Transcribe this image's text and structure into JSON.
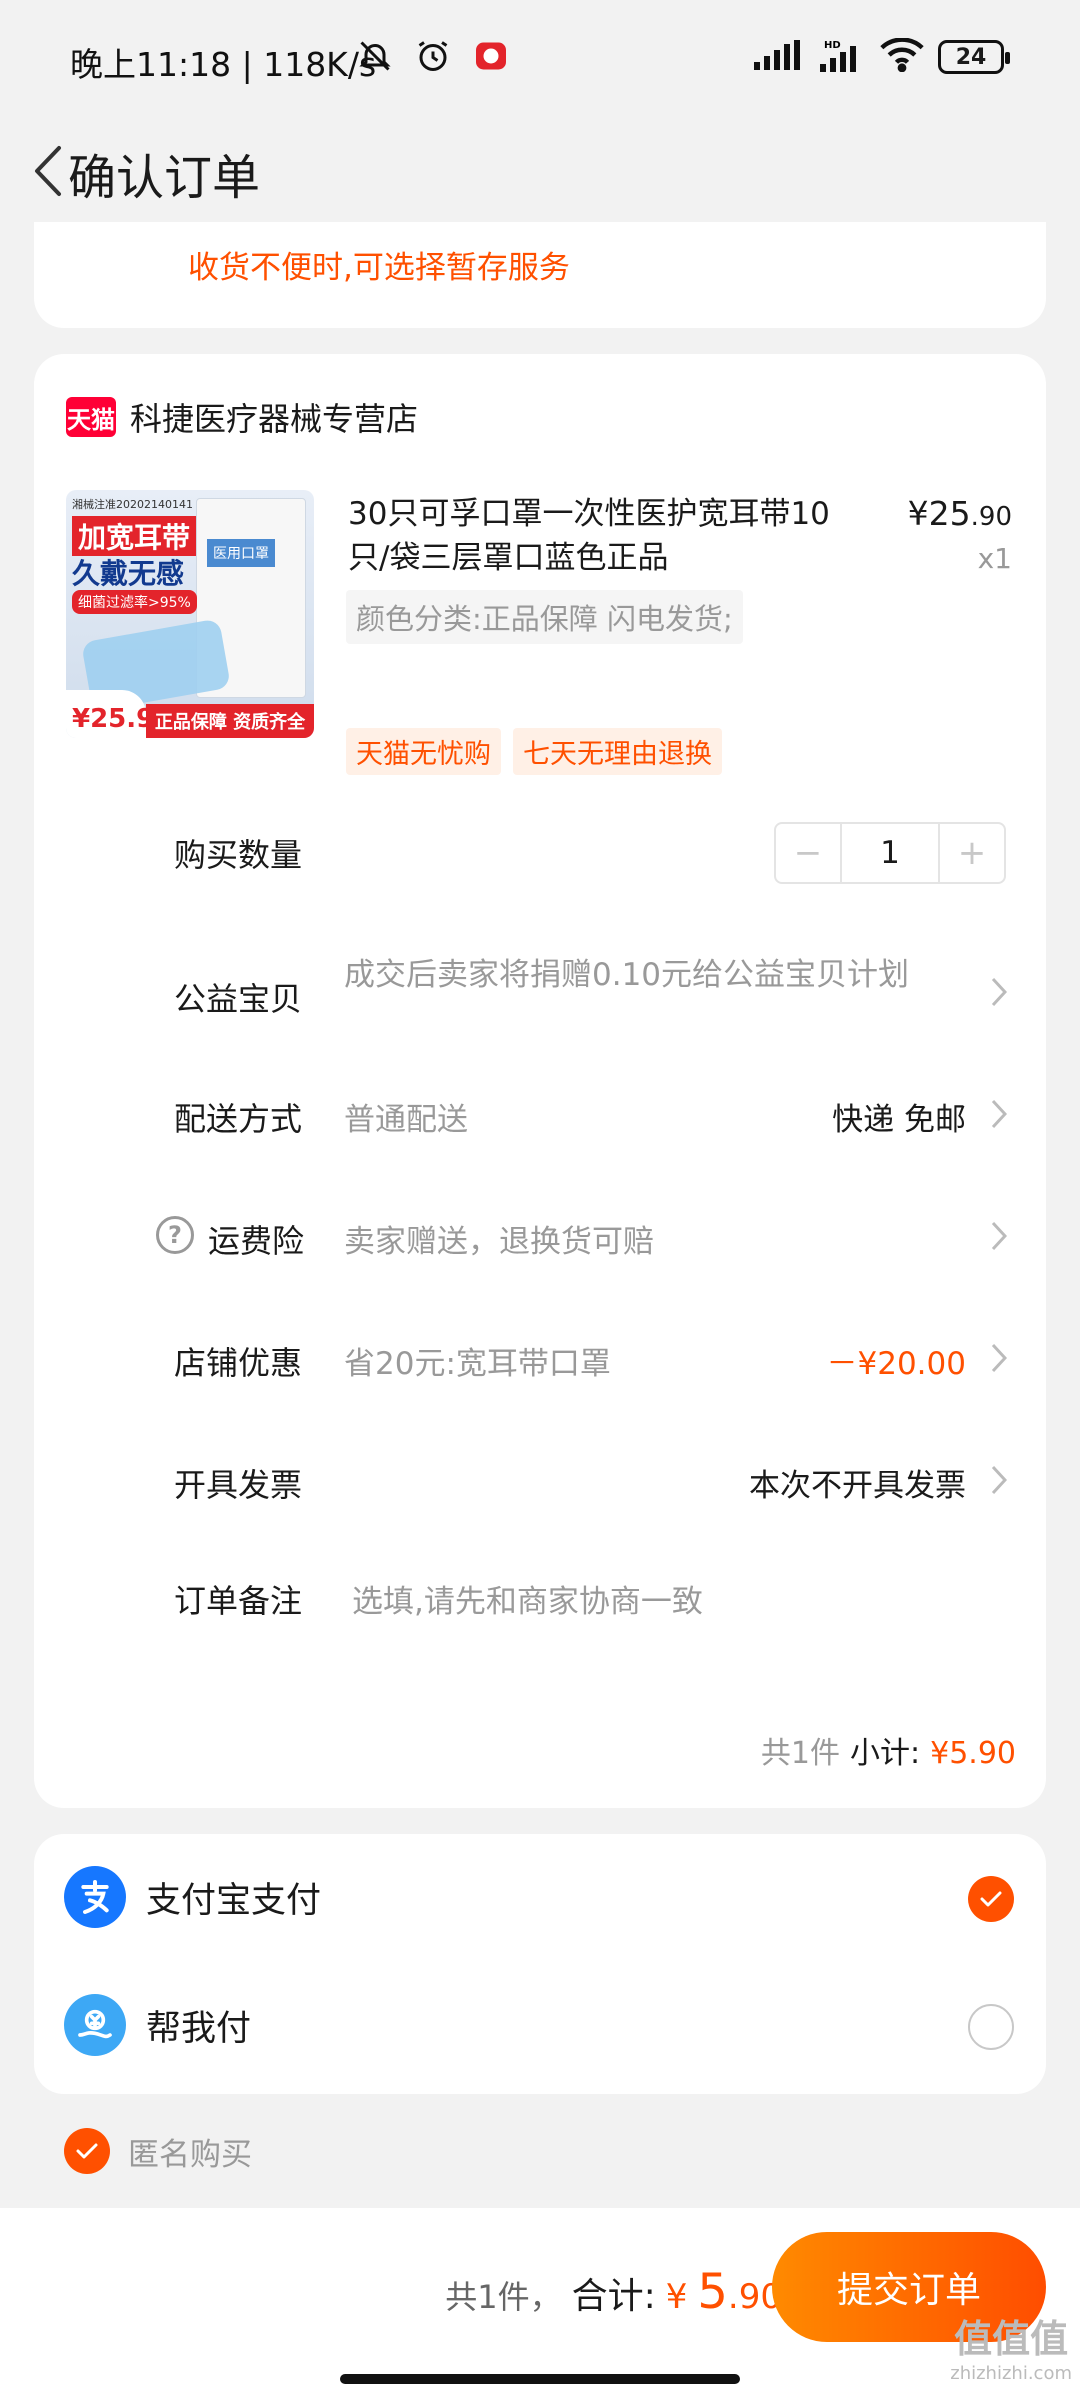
{
  "status_bar": {
    "time": "晚上11:18 | 118K/s",
    "battery": "24"
  },
  "nav": {
    "title": "确认订单"
  },
  "top_card": {
    "tip": "收货不便时,可选择暂存服务"
  },
  "store": {
    "badge": "天猫",
    "name": "科捷医疗器械专营店"
  },
  "product": {
    "image_text": {
      "tag": "湘械注准20202140141",
      "title1": "加宽耳带",
      "title2": "久戴无感",
      "title3": "细菌过滤率>95%",
      "pack_label": "医用口罩",
      "price_tag": "¥25.9",
      "banner": "正品保障 资质齐全"
    },
    "title": "30只可孚口罩一次性医护宽耳带10只/袋三层罩口蓝色正品",
    "price_int": "¥25",
    "price_dec": ".90",
    "qty": "x1",
    "spec": "颜色分类:正品保障 闪电发货;",
    "tags": [
      "天猫无忧购",
      "七天无理由退换"
    ]
  },
  "rows": {
    "quantity": {
      "label": "购买数量",
      "value": "1",
      "minus": "−",
      "plus": "+"
    },
    "charity": {
      "label": "公益宝贝",
      "sub": "成交后卖家将捐赠0.10元给公益宝贝计划"
    },
    "delivery": {
      "label": "配送方式",
      "sub": "普通配送",
      "value": "快递 免邮"
    },
    "freight_insurance": {
      "label": "运费险",
      "sub": "卖家赠送，退换货可赔"
    },
    "store_discount": {
      "label": "店铺优惠",
      "sub": "省20元:宽耳带口罩",
      "value": "－¥20.00"
    },
    "invoice": {
      "label": "开具发票",
      "value": "本次不开具发票"
    },
    "note": {
      "label": "订单备注",
      "placeholder": "选填,请先和商家协商一致"
    }
  },
  "subtotal": {
    "count": "共1件",
    "label": "小计:",
    "amount": "¥5.90"
  },
  "payment": {
    "options": [
      {
        "label": "支付宝支付",
        "icon": "alipay-icon",
        "selected": true
      },
      {
        "label": "帮我付",
        "icon": "help-pay-icon",
        "selected": false
      }
    ]
  },
  "anonymous": {
    "label": "匿名购买",
    "checked": true
  },
  "bottom": {
    "count": "共1件，",
    "total_label": "合计:",
    "currency": "¥",
    "total_int": "5",
    "total_dec": ".90",
    "submit": "提交订单"
  },
  "watermark": {
    "main": "值值值",
    "sub": "zhizhizhi.com"
  },
  "colors": {
    "accent": "#ff5000",
    "alipay": "#1677ff",
    "tmall": "#ff0036"
  }
}
